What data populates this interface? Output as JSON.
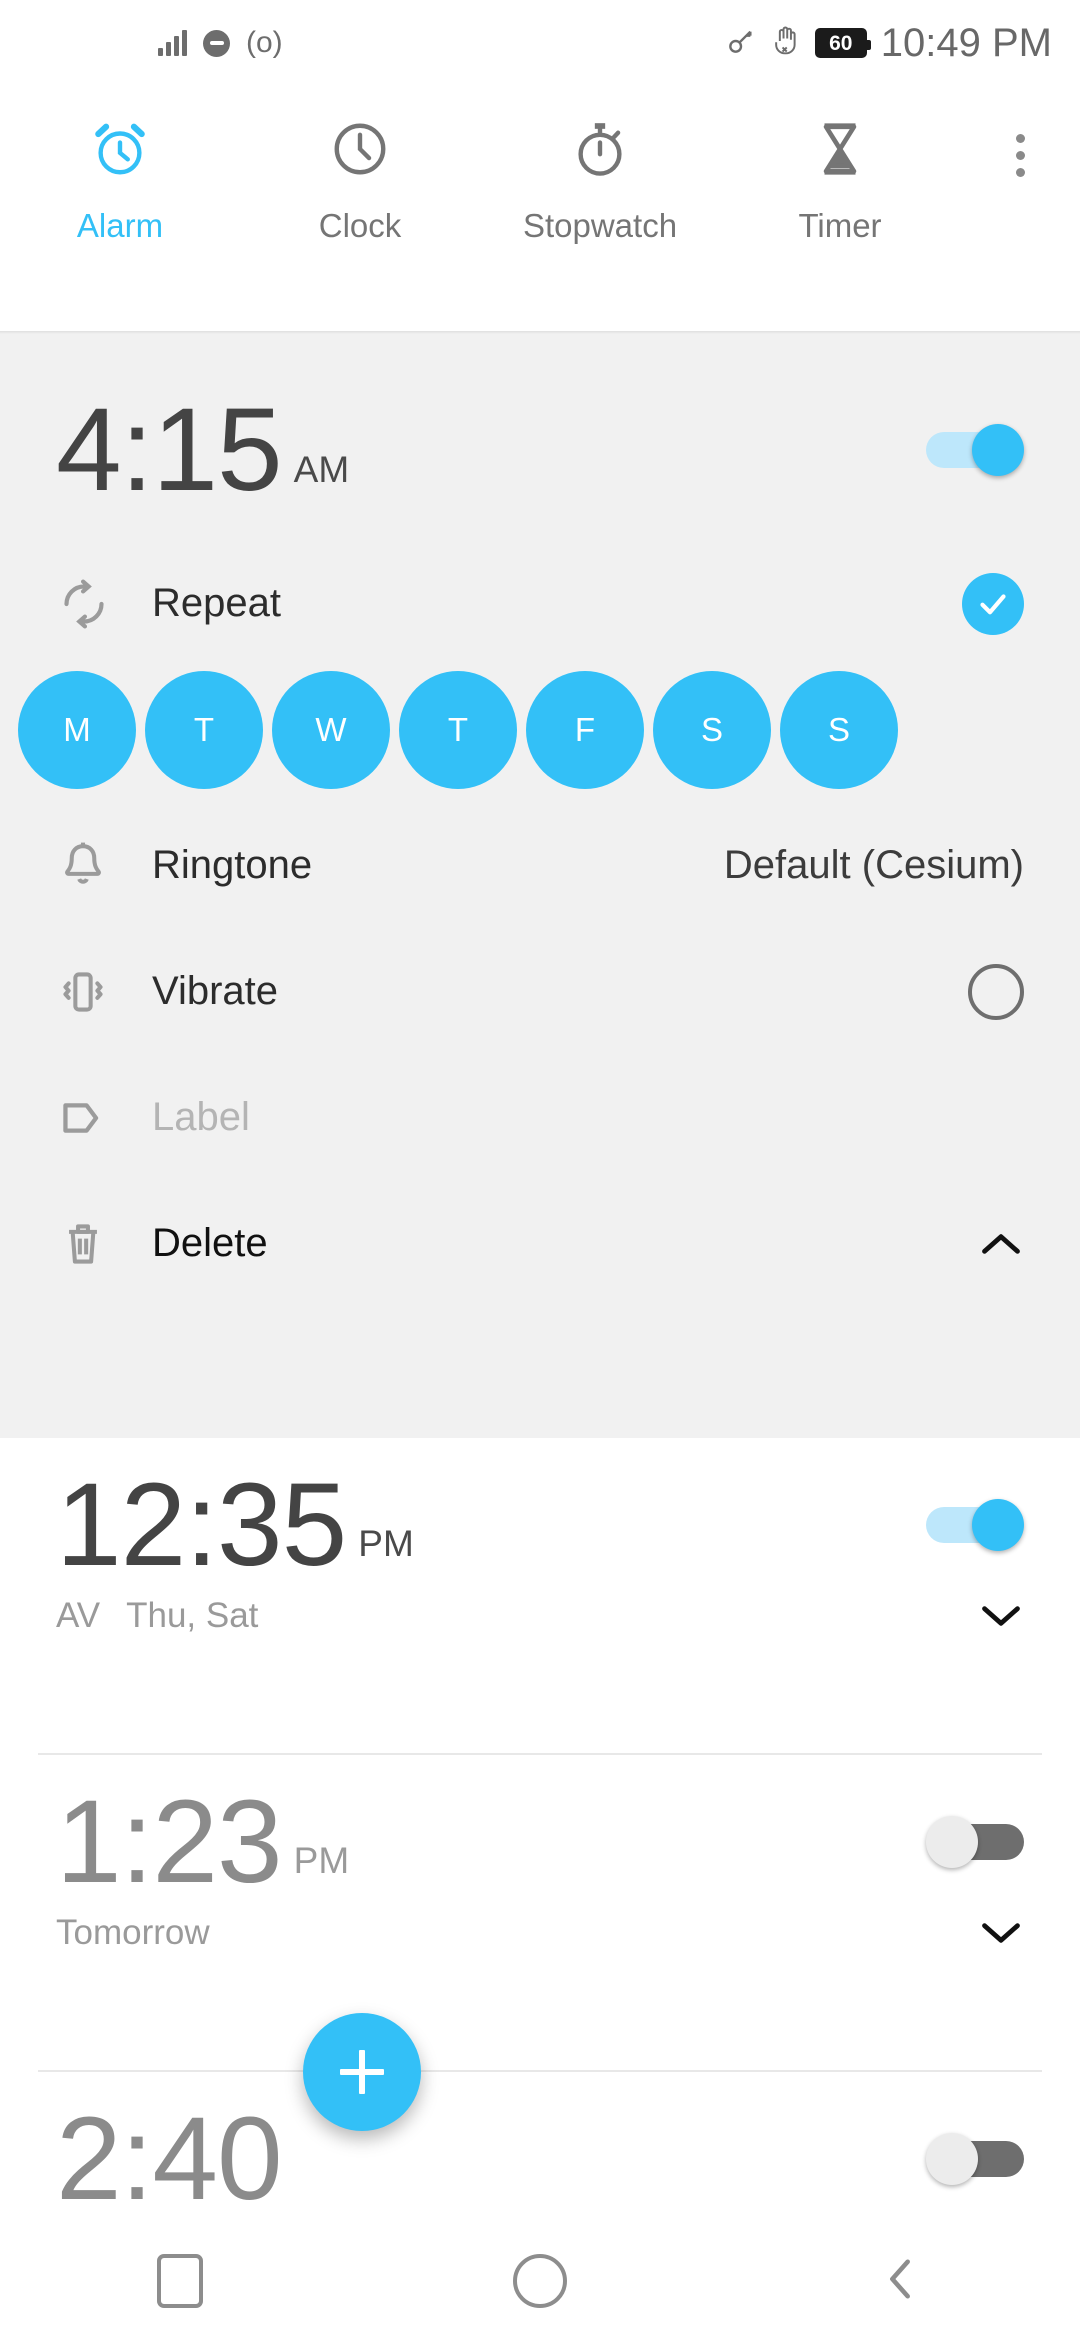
{
  "status_bar": {
    "time": "10:49 PM",
    "battery_level": "60",
    "left_icons": [
      "signal-bars-icon",
      "do-not-disturb-icon",
      "cast-icon"
    ],
    "right_icons": [
      "vpn-key-icon",
      "no-touch-icon",
      "battery-icon"
    ],
    "cast_glyph": "(o)",
    "key_glyph": "⚷",
    "hand_glyph": "✋"
  },
  "tabs": [
    {
      "label": "Alarm",
      "icon": "alarm-clock-icon",
      "active": true
    },
    {
      "label": "Clock",
      "icon": "clock-icon",
      "active": false
    },
    {
      "label": "Stopwatch",
      "icon": "stopwatch-icon",
      "active": false
    },
    {
      "label": "Timer",
      "icon": "hourglass-icon",
      "active": false
    }
  ],
  "overflow_menu": {
    "name": "more-options",
    "glyph": "⋮"
  },
  "colors": {
    "accent": "#33c0f7",
    "accent_light": "#bde7fb",
    "card_bg": "#f1f1f1",
    "text_primary": "#444444",
    "text_muted": "#9a9a9a",
    "toggle_off_track": "#6e6e6e"
  },
  "expanded_alarm": {
    "time": "4:15",
    "meridiem": "AM",
    "enabled": true,
    "toggle_state": "on",
    "repeat": {
      "label": "Repeat",
      "icon": "repeat-icon",
      "checked": true
    },
    "days": [
      {
        "letter": "M",
        "name": "monday",
        "selected": true
      },
      {
        "letter": "T",
        "name": "tuesday",
        "selected": true
      },
      {
        "letter": "W",
        "name": "wednesday",
        "selected": true
      },
      {
        "letter": "T",
        "name": "thursday",
        "selected": true
      },
      {
        "letter": "F",
        "name": "friday",
        "selected": true
      },
      {
        "letter": "S",
        "name": "saturday",
        "selected": true
      },
      {
        "letter": "S",
        "name": "sunday",
        "selected": true
      }
    ],
    "ringtone": {
      "label": "Ringtone",
      "icon": "bell-icon",
      "value": "Default (Cesium)"
    },
    "vibrate": {
      "label": "Vibrate",
      "icon": "vibrate-icon",
      "checked": false
    },
    "label_field": {
      "placeholder": "Label",
      "icon": "tag-icon",
      "value": ""
    },
    "delete": {
      "label": "Delete",
      "icon": "trash-icon",
      "collapse_icon": "chevron-up-icon"
    }
  },
  "alarms": [
    {
      "time": "12:35",
      "meridiem": "PM",
      "enabled": true,
      "toggle_state": "on",
      "label": "AV",
      "days_text": "Thu, Sat",
      "expand_icon": "chevron-down-icon"
    },
    {
      "time": "1:23",
      "meridiem": "PM",
      "enabled": false,
      "toggle_state": "off",
      "label": "",
      "days_text": "Tomorrow",
      "expand_icon": "chevron-down-icon"
    },
    {
      "time": "2:40",
      "meridiem": "",
      "enabled": false,
      "toggle_state": "off",
      "label": "",
      "days_text": "",
      "expand_icon": "chevron-down-icon"
    }
  ],
  "fab": {
    "name": "add-alarm-button",
    "glyph": "+"
  },
  "nav_bar": {
    "recents": "recents-button",
    "home": "home-button",
    "back": "back-button",
    "back_glyph": "‹"
  }
}
